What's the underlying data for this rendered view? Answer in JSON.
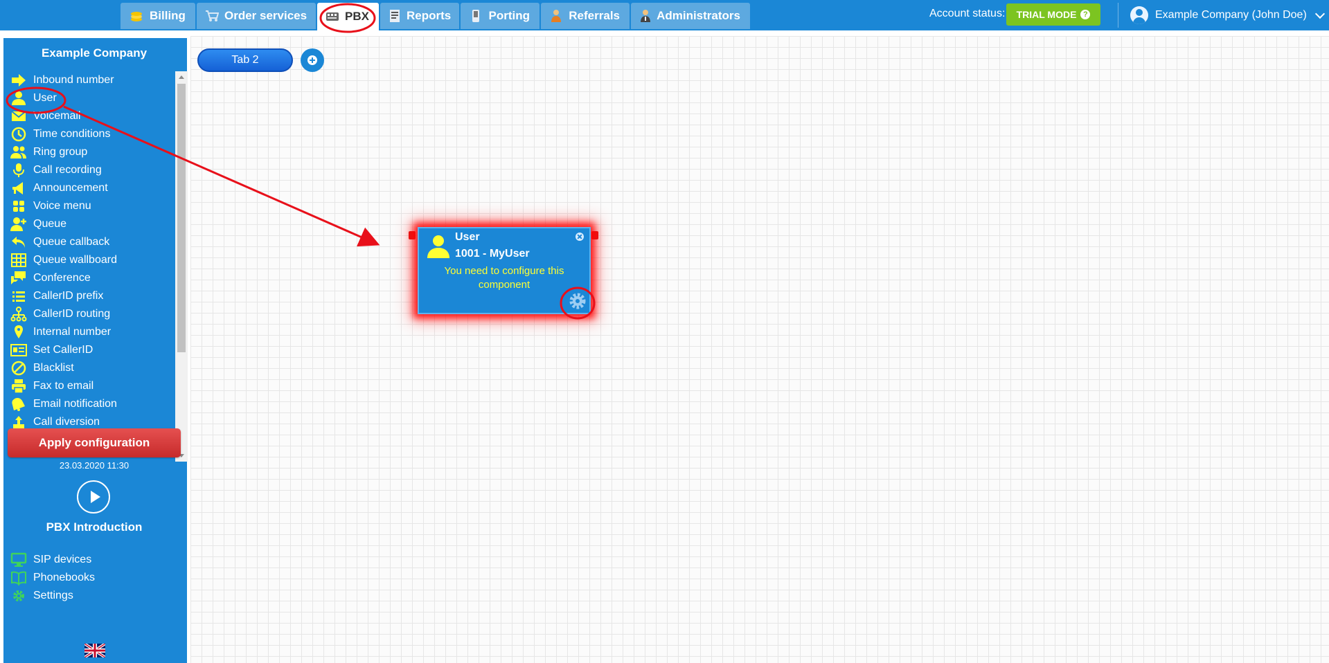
{
  "nav": {
    "tabs": [
      {
        "label": "Billing",
        "icon": "coins-icon"
      },
      {
        "label": "Order services",
        "icon": "cart-icon"
      },
      {
        "label": "PBX",
        "icon": "pbx-icon",
        "active": true
      },
      {
        "label": "Reports",
        "icon": "report-icon"
      },
      {
        "label": "Porting",
        "icon": "phone-icon"
      },
      {
        "label": "Referrals",
        "icon": "person-icon"
      },
      {
        "label": "Administrators",
        "icon": "admin-icon"
      }
    ]
  },
  "account": {
    "status_label": "Account status:",
    "status_badge": "TRIAL MODE",
    "user_name": "Example Company (John Doe)"
  },
  "sidebar": {
    "company": "Example Company",
    "components": [
      {
        "label": "Inbound number",
        "icon": "arrow-right-icon"
      },
      {
        "label": "User",
        "icon": "user-icon"
      },
      {
        "label": "Voicemail",
        "icon": "envelope-icon"
      },
      {
        "label": "Time conditions",
        "icon": "clock-icon"
      },
      {
        "label": "Ring group",
        "icon": "users-icon"
      },
      {
        "label": "Call recording",
        "icon": "microphone-icon"
      },
      {
        "label": "Announcement",
        "icon": "megaphone-icon"
      },
      {
        "label": "Voice menu",
        "icon": "grid-icon"
      },
      {
        "label": "Queue",
        "icon": "user-plus-icon"
      },
      {
        "label": "Queue callback",
        "icon": "reply-icon"
      },
      {
        "label": "Queue wallboard",
        "icon": "table-icon"
      },
      {
        "label": "Conference",
        "icon": "chat-icon"
      },
      {
        "label": "CallerID prefix",
        "icon": "list-icon"
      },
      {
        "label": "CallerID routing",
        "icon": "sitemap-icon"
      },
      {
        "label": "Internal number",
        "icon": "map-pin-icon"
      },
      {
        "label": "Set CallerID",
        "icon": "id-card-icon"
      },
      {
        "label": "Blacklist",
        "icon": "ban-icon"
      },
      {
        "label": "Fax to email",
        "icon": "printer-icon"
      },
      {
        "label": "Email notification",
        "icon": "bell-icon"
      },
      {
        "label": "Call diversion",
        "icon": "diversion-icon"
      }
    ],
    "apply_button": "Apply configuration",
    "applied_at": "23.03.2020 11:30",
    "intro_label": "PBX Introduction",
    "links": [
      {
        "label": "SIP devices",
        "icon": "monitor-icon"
      },
      {
        "label": "Phonebooks",
        "icon": "book-icon"
      },
      {
        "label": "Settings",
        "icon": "gear-icon"
      }
    ],
    "language_flag": "uk-flag-icon"
  },
  "canvas": {
    "active_tab": "Tab 2",
    "component": {
      "type": "User",
      "name": "1001 - MyUser",
      "message": "You need to configure this component"
    }
  },
  "colors": {
    "primary": "#1b87d6",
    "trial": "#7cc421",
    "apply": "#d93a3a",
    "icon_yellow": "#ffff33",
    "link_green": "#3fd35c",
    "annotation_red": "#e8101a"
  }
}
